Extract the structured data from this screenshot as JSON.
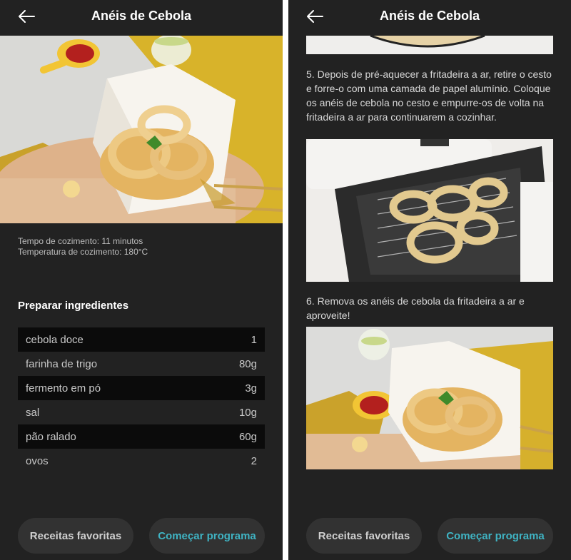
{
  "left_screen": {
    "header": {
      "title": "Anéis de Cebola"
    },
    "info": {
      "cook_time": "Tempo de cozimento: 11 minutos",
      "cook_temp": "Temperatura de cozimento: 180°C"
    },
    "ingredients_title": "Preparar ingredientes",
    "ingredients": [
      {
        "name": "cebola doce",
        "qty": "1"
      },
      {
        "name": "farinha de trigo",
        "qty": "80g"
      },
      {
        "name": "fermento em pó",
        "qty": "3g"
      },
      {
        "name": "sal",
        "qty": "10g"
      },
      {
        "name": "pão ralado",
        "qty": "60g"
      },
      {
        "name": "ovos",
        "qty": "2"
      }
    ],
    "buttons": {
      "favorites": "Receitas favoritas",
      "start": "Começar programa"
    }
  },
  "right_screen": {
    "header": {
      "title": "Anéis de Cebola"
    },
    "steps": {
      "step5": "5. Depois de pré-aquecer a fritadeira a ar, retire o cesto e forre-o com uma camada de papel alumínio. Coloque os anéis de cebola no cesto e empurre-os de volta na fritadeira a ar para continuarem a cozinhar.",
      "step6": "6. Remova os anéis de cebola da fritadeira a ar e aproveite!"
    },
    "buttons": {
      "favorites": "Receitas favoritas",
      "start": "Começar programa"
    }
  },
  "icons": {
    "back": "arrow-left-icon"
  },
  "colors": {
    "background": "#222222",
    "accent": "#3fb3c3",
    "button_bg": "#323232",
    "row_dark": "#0b0b0b"
  }
}
